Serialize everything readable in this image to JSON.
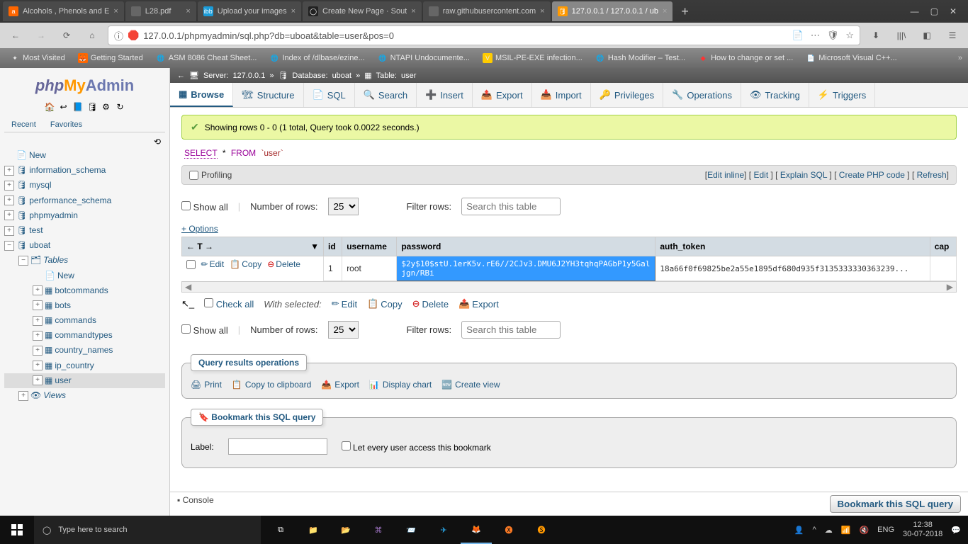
{
  "browser": {
    "tabs": [
      {
        "title": "Alcohols , Phenols and E",
        "favicon": "🅰"
      },
      {
        "title": "L28.pdf",
        "favicon": ""
      },
      {
        "title": "Upload your images",
        "favicon": "ibb"
      },
      {
        "title": "Create New Page · Sout",
        "favicon": "⬤"
      },
      {
        "title": "raw.githubusercontent.com",
        "favicon": ""
      },
      {
        "title": "127.0.0.1 / 127.0.0.1 / ub",
        "favicon": "pMA",
        "active": true
      }
    ],
    "url": "127.0.0.1/phpmyadmin/sql.php?db=uboat&table=user&pos=0",
    "bookmarks": [
      {
        "label": "Most Visited"
      },
      {
        "label": "Getting Started"
      },
      {
        "label": "ASM 8086 Cheat Sheet..."
      },
      {
        "label": "Index of /dlbase/ezine..."
      },
      {
        "label": "NTAPI Undocumente..."
      },
      {
        "label": "MSIL-PE-EXE infection..."
      },
      {
        "label": "Hash Modifier – Test..."
      },
      {
        "label": "How to change or set ..."
      },
      {
        "label": "Microsoft Visual C++..."
      }
    ]
  },
  "sidebar": {
    "tabs": {
      "recent": "Recent",
      "favorites": "Favorites"
    },
    "tree": [
      {
        "label": "New",
        "type": "new"
      },
      {
        "label": "information_schema",
        "type": "db",
        "expand": "+"
      },
      {
        "label": "mysql",
        "type": "db",
        "expand": "+"
      },
      {
        "label": "performance_schema",
        "type": "db",
        "expand": "+"
      },
      {
        "label": "phpmyadmin",
        "type": "db",
        "expand": "+"
      },
      {
        "label": "test",
        "type": "db",
        "expand": "+"
      },
      {
        "label": "uboat",
        "type": "db",
        "expand": "-"
      }
    ],
    "uboat_children": {
      "tables_label": "Tables",
      "new": "New",
      "tables": [
        "botcommands",
        "bots",
        "commands",
        "commandtypes",
        "country_names",
        "ip_country",
        "user"
      ],
      "views": "Views"
    }
  },
  "breadcrumb": {
    "server_label": "Server:",
    "server": "127.0.0.1",
    "db_label": "Database:",
    "db": "uboat",
    "table_label": "Table:",
    "table": "user"
  },
  "toolbar": {
    "browse": "Browse",
    "structure": "Structure",
    "sql": "SQL",
    "search": "Search",
    "insert": "Insert",
    "export": "Export",
    "import": "Import",
    "privileges": "Privileges",
    "operations": "Operations",
    "tracking": "Tracking",
    "triggers": "Triggers"
  },
  "content": {
    "success": "Showing rows 0 - 0 (1 total, Query took 0.0022 seconds.)",
    "sql": {
      "select": "SELECT",
      "star": "*",
      "from": "FROM",
      "table": "`user`"
    },
    "actions": {
      "profiling": "Profiling",
      "edit_inline": "Edit inline",
      "edit": "Edit",
      "explain": "Explain SQL",
      "php": "Create PHP code",
      "refresh": "Refresh"
    },
    "filter": {
      "showall": "Show all",
      "numrows": "Number of rows:",
      "rows_value": "25",
      "filterlabel": "Filter rows:",
      "placeholder": "Search this table"
    },
    "options": "+ Options",
    "table": {
      "headers": {
        "id": "id",
        "username": "username",
        "password": "password",
        "auth_token": "auth_token",
        "cap": "cap"
      },
      "row_actions": {
        "edit": "Edit",
        "copy": "Copy",
        "delete": "Delete"
      },
      "rows": [
        {
          "id": "1",
          "username": "root",
          "password": "$2y$10$stU.1erK5v.rE6//2CJv3.DMU6J2YH3tqhqPAGbP1y5Galjgn/RBi",
          "auth_token": "18a66f0f69825be2a55e1895df680d935f3135333330363239..."
        }
      ]
    },
    "batch": {
      "checkall": "Check all",
      "withsel": "With selected:",
      "edit": "Edit",
      "copy": "Copy",
      "delete": "Delete",
      "export": "Export"
    },
    "ops": {
      "legend": "Query results operations",
      "print": "Print",
      "clip": "Copy to clipboard",
      "export": "Export",
      "chart": "Display chart",
      "view": "Create view"
    },
    "bookmark": {
      "legend": "Bookmark this SQL query",
      "label": "Label:",
      "everyuser": "Let every user access this bookmark",
      "button": "Bookmark this SQL query"
    },
    "console": "Console"
  },
  "taskbar": {
    "search_placeholder": "Type here to search",
    "lang": "ENG",
    "time": "12:38",
    "date": "30-07-2018"
  }
}
